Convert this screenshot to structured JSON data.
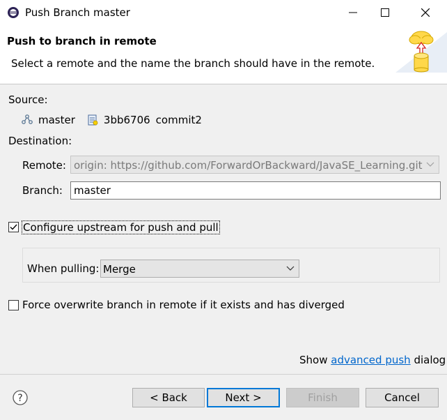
{
  "window": {
    "title": "Push Branch master"
  },
  "header": {
    "title": "Push to branch in remote",
    "description": "Select a remote and the name the branch should have in the remote."
  },
  "source": {
    "label": "Source:",
    "branch": "master",
    "commit_id": "3bb6706",
    "commit_message": "commit2"
  },
  "destination": {
    "label": "Destination:",
    "remote_label": "Remote:",
    "remote_value": "origin: https://github.com/ForwardOrBackward/JavaSE_Learning.git",
    "branch_label": "Branch:",
    "branch_value": "master"
  },
  "upstream": {
    "checkbox_label": "Configure upstream for push and pull",
    "checked": true,
    "pull_label": "When pulling:",
    "pull_value": "Merge"
  },
  "force": {
    "checkbox_label": "Force overwrite branch in remote if it exists and has diverged",
    "checked": false
  },
  "advanced": {
    "prefix": "Show",
    "link": "advanced push",
    "suffix": "dialog"
  },
  "buttons": {
    "back": "< Back",
    "next": "Next >",
    "finish": "Finish",
    "cancel": "Cancel"
  },
  "colors": {
    "link": "#0066cc",
    "primary_border": "#0078d7"
  },
  "icons": [
    "app-icon",
    "minimize-icon",
    "maximize-icon",
    "close-icon",
    "cloud-push-icon",
    "branch-icon",
    "commit-icon",
    "dropdown-arrow-icon",
    "checkmark-icon",
    "help-icon"
  ]
}
